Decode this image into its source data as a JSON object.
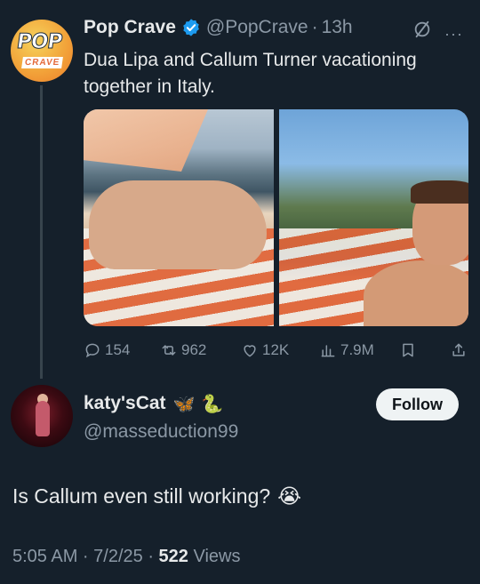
{
  "tweet": {
    "author_name": "Pop Crave",
    "avatar_text_top": "POP",
    "avatar_text_bottom": "CRAVE",
    "handle": "@PopCrave",
    "separator": "·",
    "time": "13h",
    "text": "Dua Lipa and Callum Turner vacationing together in Italy.",
    "more_label": "···",
    "stats": {
      "replies": "154",
      "reposts": "962",
      "likes": "12K",
      "views": "7.9M"
    }
  },
  "reply": {
    "author_name": "katy'sCat",
    "emojis": "🦋 🐍",
    "handle": "@masseduction99",
    "follow_label": "Follow",
    "text": "Is Callum even still working?",
    "text_emoji": "😭",
    "timestamp": "5:05 AM · 7/2/25 · ",
    "views_count": "522",
    "views_label": " Views"
  },
  "colors": {
    "background": "#15202b",
    "verified": "#1d9bf0",
    "secondary_text": "#8b98a5",
    "primary_text": "#e7e9ea"
  },
  "icons": [
    "verified-badge-icon",
    "grok-icon",
    "more-icon",
    "reply-icon",
    "repost-icon",
    "like-icon",
    "views-icon",
    "bookmark-icon",
    "share-icon"
  ]
}
